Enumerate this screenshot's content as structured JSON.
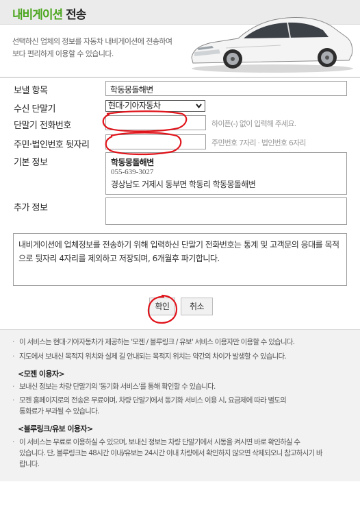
{
  "header": {
    "title_green": "내비게이션",
    "title_dark": "전송"
  },
  "intro": {
    "line1": "선택하신 업체의 정보를 자동차 내비게이션에 전송하여",
    "line2": "보다 편리하게 이용할 수 있습니다."
  },
  "form": {
    "send_item_label": "보낼 항목",
    "send_item_value": "학동몽돌해변",
    "receiver_label": "수신 단말기",
    "receiver_selected": "현대·기아자동차",
    "phone_label": "단말기 전화번호",
    "phone_value": "",
    "phone_hint": "하이픈(-) 없이 입력해 주세요.",
    "idnum_label": "주민·법인번호 뒷자리",
    "idnum_value": "",
    "idnum_hint": "주민번호 7자리 · 법인번호 6자리",
    "basic_info_label": "기본 정보",
    "basic_info": {
      "name": "학동몽돌해변",
      "tel": "055-639-3027",
      "address": "경상남도 거제시 동부면 학동리 학동몽돌해변"
    },
    "extra_info_label": "추가 정보",
    "extra_info_value": "",
    "notice": "내비게이션에 업체정보를 전송하기 위해 입력하신 단말기 전화번호는 통계 및 고객문의 응대를 목적으로 뒷자리 4자리를 제외하고 저장되며, 6개월후 파기합니다."
  },
  "buttons": {
    "confirm": "확인",
    "cancel": "취소"
  },
  "footer": {
    "item1": "이 서비스는 현대·기아자동차가 제공하는 '모젠 / 블루링크 / 유보' 서비스 이용자만 이용할 수 있습니다.",
    "item2": "지도에서 보내신 목적지 위치와 실제 길 안내되는 목적지 위치는 약간의 차이가 발생할 수 있습니다.",
    "mozen_heading": "<모젠 이용자>",
    "mozen_item1": "보내신 정보는 차량 단말기의 '동기화 서비스'를 통해 확인할 수 있습니다.",
    "mozen_item2_line1": "모젠 홈페이지로의 전송은 무료이며, 차량 단말기에서 동기화 서비스 이용 시, 요금제에 따라 별도의",
    "mozen_item2_line2": "통화료가 부과될 수 있습니다.",
    "blue_heading": "<블루링크/유보 이용자>",
    "blue_item1_line1": "이 서비스는 무료로 이용하실 수 있으며, 보내신 정보는 차량 단말기에서 시동을 켜시면 바로 확인하실 수",
    "blue_item1_line2": "있습니다. 단, 블루링크는 48시간 이내/유보는 24시간 이내 차량에서 확인하지 않으면 삭제되오니 참고하시기 바",
    "blue_item1_line3": "랍니다."
  },
  "icons": {
    "select_arrow": "chevron-down-icon",
    "car": "car-image"
  },
  "colors": {
    "accent_green": "#4aa51c",
    "annotation_red": "#e0141b"
  }
}
